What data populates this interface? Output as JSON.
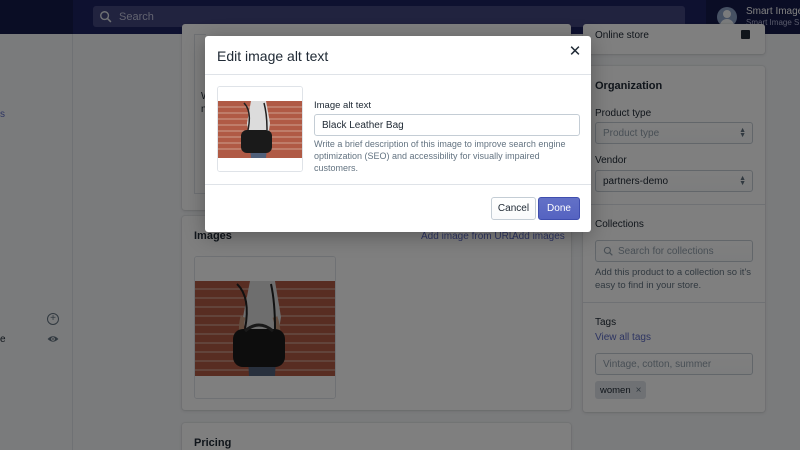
{
  "topbar": {
    "search_placeholder": "Search",
    "search_icon": "search-icon",
    "account_name": "Smart Image",
    "account_sub": "Smart Image SE"
  },
  "leftnav": {
    "fragment_s": "s",
    "fragment_e": "e",
    "add_icon": "plus-circle-icon",
    "view_icon": "eye-icon"
  },
  "main": {
    "top_card_fragment1": "W",
    "top_card_fragment2": "n",
    "images": {
      "title": "Images",
      "add_from_url": "Add image from URL",
      "add_images": "Add images"
    },
    "pricing": {
      "title": "Pricing"
    }
  },
  "sidebar": {
    "online_store": "Online store",
    "organization": {
      "title": "Organization",
      "product_type_label": "Product type",
      "product_type_placeholder": "Product type",
      "vendor_label": "Vendor",
      "vendor_value": "partners-demo",
      "collections_label": "Collections",
      "collections_placeholder": "Search for collections",
      "collections_help": "Add this product to a collection so it's easy to find in your store.",
      "tags_label": "Tags",
      "view_all_tags": "View all tags",
      "tags_placeholder": "Vintage, cotton, summer",
      "tags": [
        "women"
      ]
    }
  },
  "modal": {
    "title": "Edit image alt text",
    "field_label": "Image alt text",
    "field_value": "Black Leather Bag",
    "help": "Write a brief description of this image to improve search engine optimization (SEO) and accessibility for visually impaired customers.",
    "cancel": "Cancel",
    "done": "Done"
  },
  "colors": {
    "topbar": "#1c2260",
    "accent": "#5c6ac4",
    "primary_button": "#5563c1"
  }
}
